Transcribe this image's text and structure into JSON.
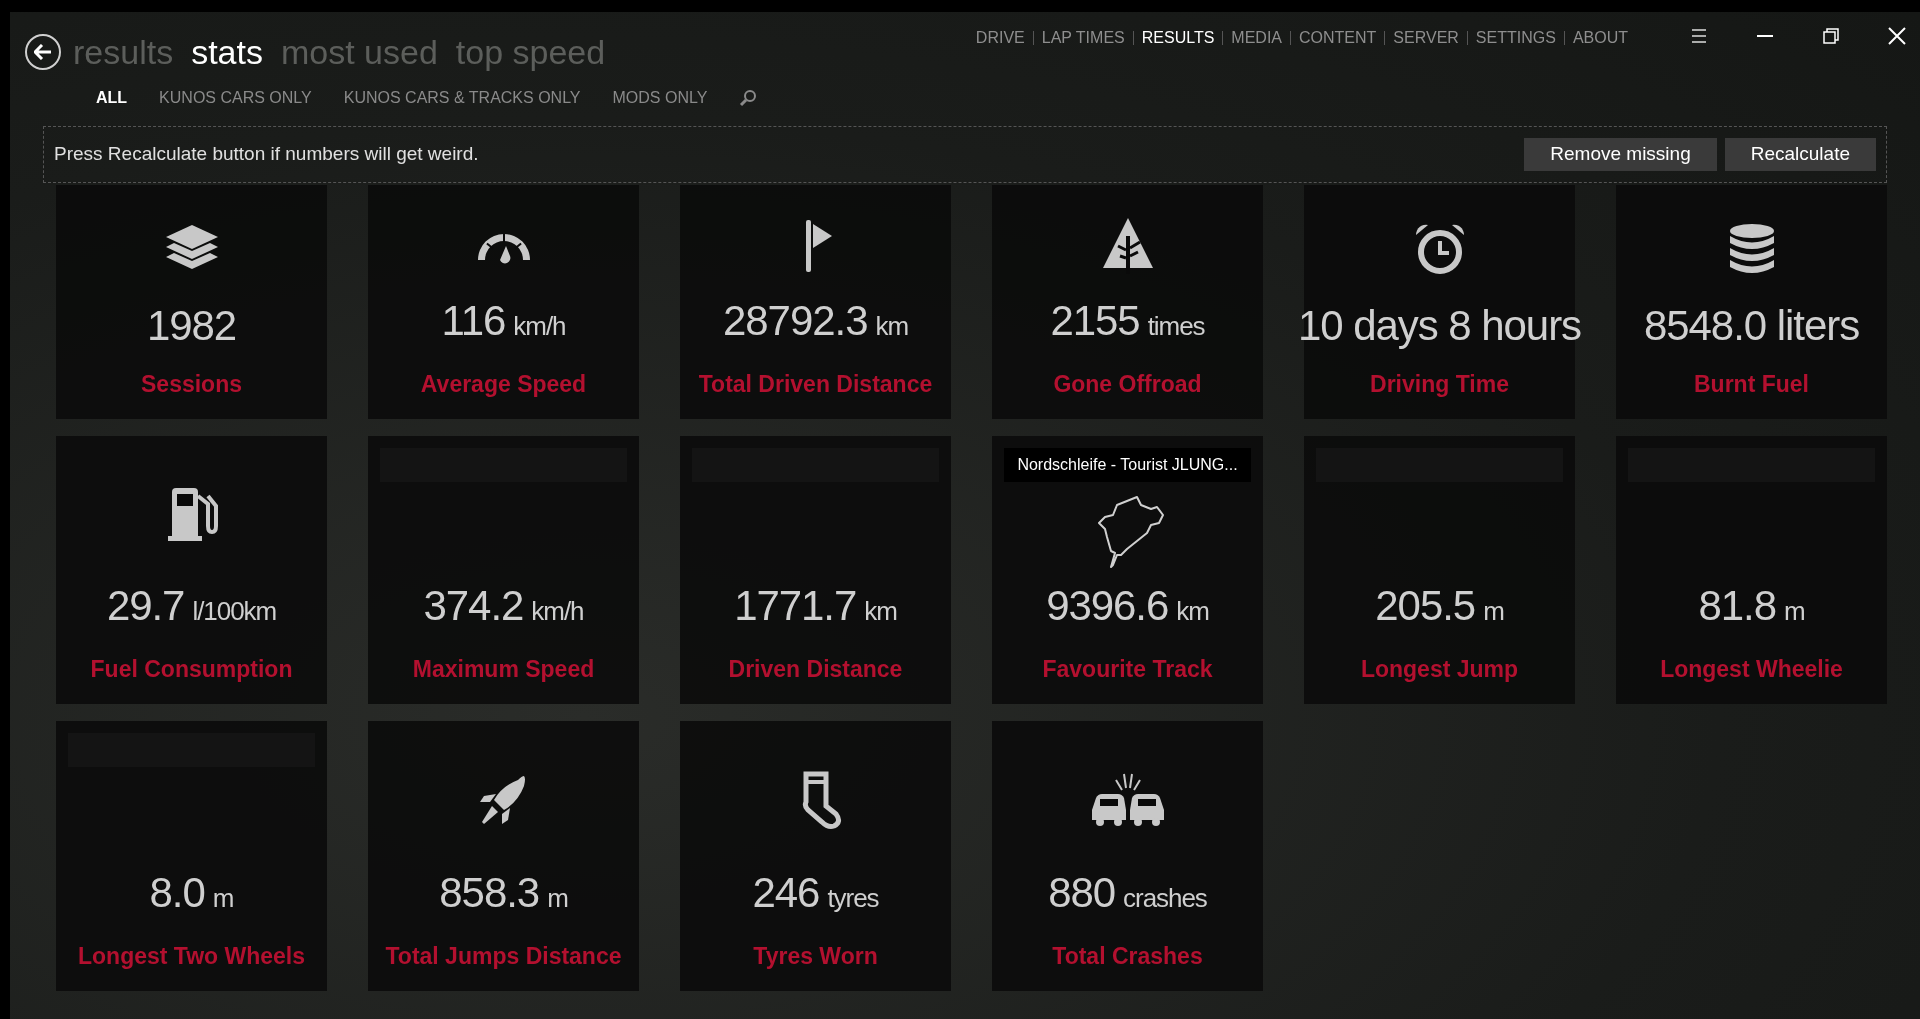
{
  "title_tabs": [
    {
      "label": "results",
      "selected": false
    },
    {
      "label": "stats",
      "selected": true
    },
    {
      "label": "most used",
      "selected": false
    },
    {
      "label": "top speed",
      "selected": false
    }
  ],
  "filters": [
    {
      "label": "ALL",
      "selected": true
    },
    {
      "label": "KUNOS CARS ONLY",
      "selected": false
    },
    {
      "label": "KUNOS CARS & TRACKS ONLY",
      "selected": false
    },
    {
      "label": "MODS ONLY",
      "selected": false
    }
  ],
  "nav": [
    {
      "label": "DRIVE",
      "selected": false
    },
    {
      "label": "LAP TIMES",
      "selected": false
    },
    {
      "label": "RESULTS",
      "selected": true
    },
    {
      "label": "MEDIA",
      "selected": false
    },
    {
      "label": "CONTENT",
      "selected": false
    },
    {
      "label": "SERVER",
      "selected": false
    },
    {
      "label": "SETTINGS",
      "selected": false
    },
    {
      "label": "ABOUT",
      "selected": false
    }
  ],
  "banner": {
    "message": "Press Recalculate button if numbers will get weird.",
    "buttons": [
      "Remove missing",
      "Recalculate"
    ]
  },
  "tiles": [
    {
      "kind": "icon",
      "value": "1982",
      "label": "Sessions"
    },
    {
      "kind": "icon",
      "value": "116",
      "unit": "km/h",
      "label": "Average Speed"
    },
    {
      "kind": "icon",
      "value": "28792.3",
      "unit": "km",
      "label": "Total Driven Distance"
    },
    {
      "kind": "icon",
      "value": "2155",
      "unit": "times",
      "label": "Gone Offroad"
    },
    {
      "kind": "icon",
      "value": "10 days 8 hours",
      "label": "Driving Time"
    },
    {
      "kind": "icon",
      "value": "8548.0 liters",
      "label": "Burnt Fuel"
    },
    {
      "kind": "icon",
      "value": "29.7",
      "unit": "l/100km",
      "label": "Fuel Consumption"
    },
    {
      "kind": "bar",
      "value": "374.2",
      "unit": "km/h",
      "label": "Maximum Speed"
    },
    {
      "kind": "bar",
      "value": "1771.7",
      "unit": "km",
      "label": "Driven Distance"
    },
    {
      "kind": "track",
      "caption": "Nordschleife - Tourist JLUNG...",
      "value": "9396.6",
      "unit": "km",
      "label": "Favourite Track"
    },
    {
      "kind": "bar",
      "value": "205.5",
      "unit": "m",
      "label": "Longest Jump"
    },
    {
      "kind": "bar",
      "value": "81.8",
      "unit": "m",
      "label": "Longest Wheelie"
    },
    {
      "kind": "bar",
      "value": "8.0",
      "unit": "m",
      "label": "Longest Two Wheels"
    },
    {
      "kind": "icon",
      "value": "858.3",
      "unit": "m",
      "label": "Total Jumps Distance"
    },
    {
      "kind": "icon",
      "value": "246",
      "unit": "tyres",
      "label": "Tyres Worn"
    },
    {
      "kind": "icon",
      "value": "880",
      "unit": "crashes",
      "label": "Total Crashes"
    }
  ]
}
